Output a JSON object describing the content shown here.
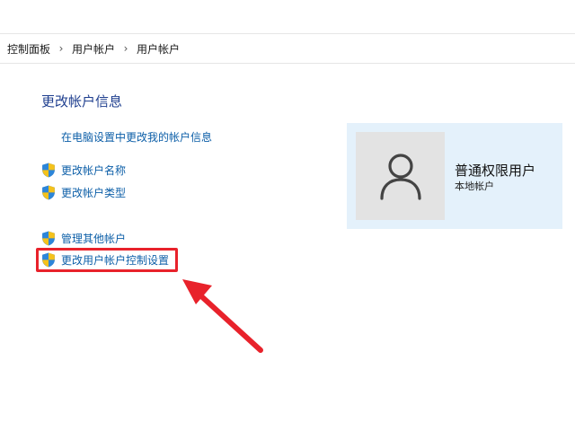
{
  "breadcrumb": {
    "items": [
      "控制面板",
      "用户帐户",
      "用户帐户"
    ],
    "separator": "›"
  },
  "main": {
    "title": "更改帐户信息",
    "links": {
      "pc_settings": "在电脑设置中更改我的帐户信息",
      "change_name": "更改帐户名称",
      "change_type": "更改帐户类型",
      "manage_other": "管理其他帐户",
      "uac_settings": "更改用户帐户控制设置"
    }
  },
  "account": {
    "name": "普通权限用户",
    "type": "本地帐户"
  },
  "colors": {
    "link": "#0d5fa8",
    "title": "#1f3f8f",
    "highlight": "#e8222b",
    "card_bg": "#e4f1fb",
    "avatar_bg": "#e3e3e3"
  },
  "icons": {
    "shield": "uac-shield-icon",
    "avatar": "user-silhouette-icon",
    "annotation": "red-arrow-annotation"
  }
}
